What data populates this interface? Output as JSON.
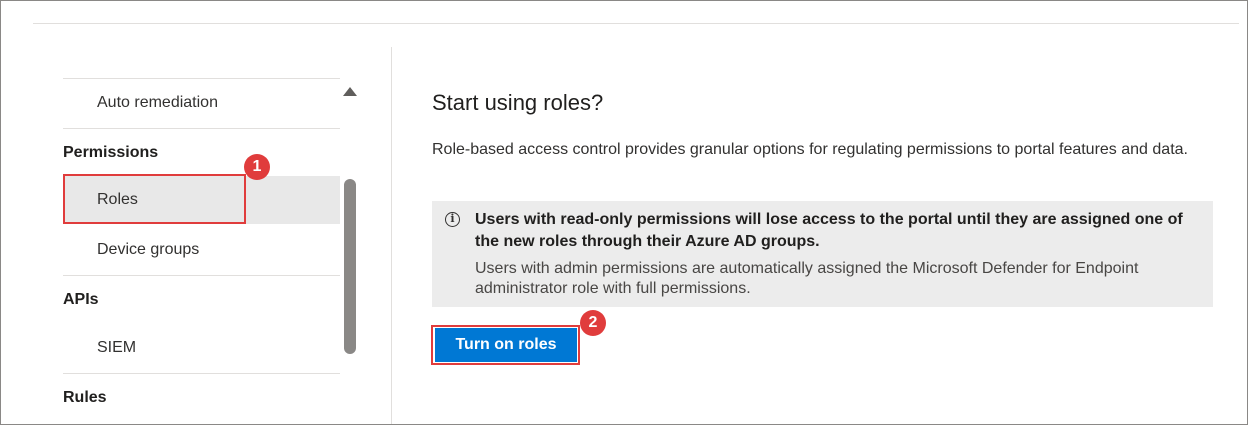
{
  "sidebar": {
    "items": [
      {
        "label": "Auto remediation"
      },
      {
        "label": "Permissions"
      },
      {
        "label": "Roles"
      },
      {
        "label": "Device groups"
      },
      {
        "label": "APIs"
      },
      {
        "label": "SIEM"
      },
      {
        "label": "Rules"
      }
    ]
  },
  "annotations": {
    "marker1": "1",
    "marker2": "2"
  },
  "main": {
    "title": "Start using roles?",
    "description": "Role-based access control provides granular options for regulating permissions to portal features and data.",
    "info": {
      "icon": "info-icon",
      "bold": "Users with read-only permissions will lose access to the portal until they are assigned one of the new roles through their Azure AD groups.",
      "text": "Users with admin permissions are automatically assigned the Microsoft Defender for Endpoint administrator role with full permissions."
    },
    "button_label": "Turn on roles"
  },
  "colors": {
    "accent": "#0078d4",
    "annotation": "#e03c3c",
    "selected_bg": "#e8e8e8",
    "info_bg": "#ececec"
  }
}
